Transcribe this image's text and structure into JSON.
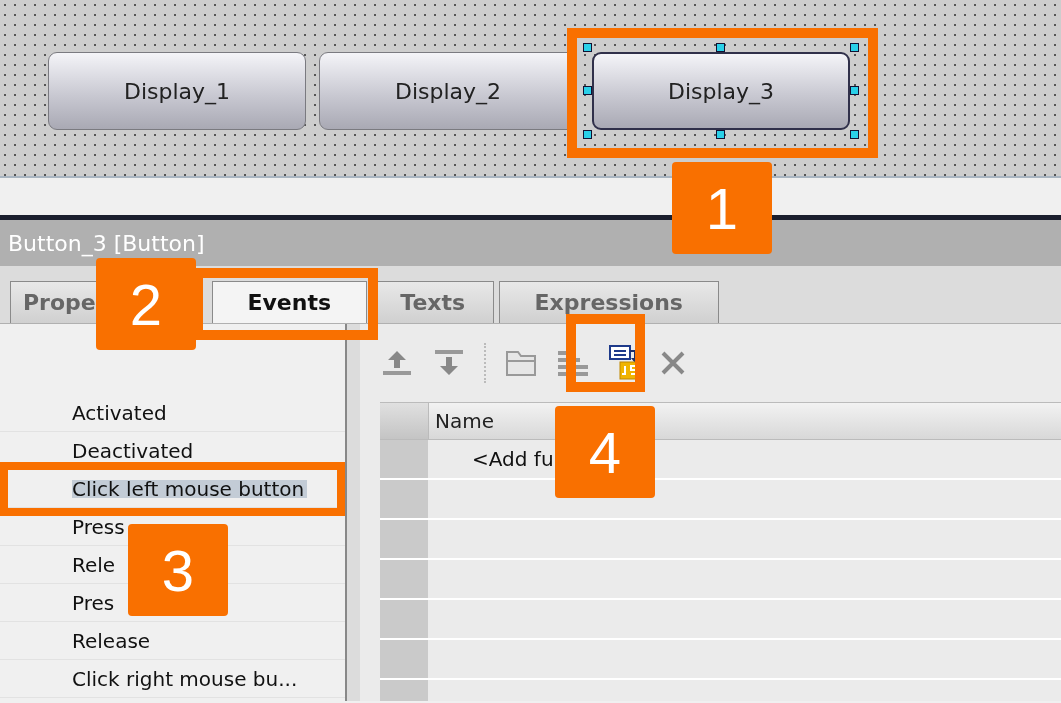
{
  "canvas": {
    "buttons": [
      {
        "label": "Display_1",
        "selected": false
      },
      {
        "label": "Display_2",
        "selected": false
      },
      {
        "label": "Display_3",
        "selected": true
      }
    ]
  },
  "inspector": {
    "title": "Button_3 [Button]",
    "tabs": [
      {
        "label": "Prope",
        "selected": false
      },
      {
        "label": "Events",
        "selected": true
      },
      {
        "label": "Texts",
        "selected": false
      },
      {
        "label": "Expressions",
        "selected": false
      }
    ],
    "events": [
      {
        "label": "Activated",
        "selected": false
      },
      {
        "label": "Deactivated",
        "selected": false
      },
      {
        "label": "Click left mouse button",
        "selected": true
      },
      {
        "label": "Press",
        "selected": false
      },
      {
        "label": "Rele",
        "selected": false
      },
      {
        "label": "Pres",
        "selected": false
      },
      {
        "label": "Release",
        "selected": false
      },
      {
        "label": "Click right mouse bu...",
        "selected": false
      }
    ],
    "table": {
      "columns": [
        "Name"
      ],
      "rows": [
        {
          "name": "<Add fu"
        }
      ]
    }
  },
  "callouts": [
    {
      "number": "1"
    },
    {
      "number": "2"
    },
    {
      "number": "3"
    },
    {
      "number": "4"
    }
  ]
}
